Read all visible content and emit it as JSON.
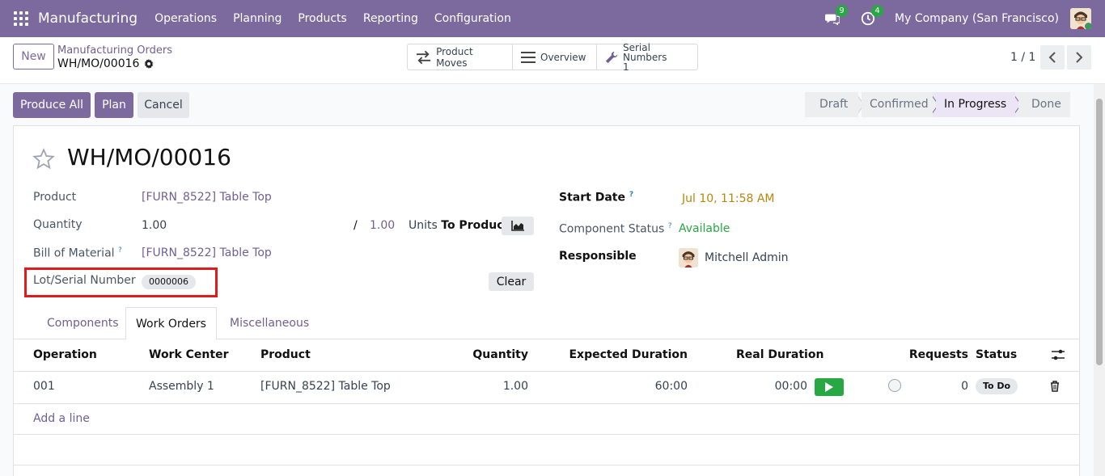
{
  "navbar": {
    "app_name": "Manufacturing",
    "menu": [
      "Operations",
      "Planning",
      "Products",
      "Reporting",
      "Configuration"
    ],
    "messages_count": "9",
    "activities_count": "4",
    "company": "My Company (San Francisco)"
  },
  "control_panel": {
    "new_label": "New",
    "breadcrumb_parent": "Manufacturing Orders",
    "breadcrumb_current": "WH/MO/00016",
    "smart_buttons": {
      "product_moves": "Product Moves",
      "overview": "Overview",
      "serial_numbers_label": "Serial Numbers",
      "serial_numbers_count": "1"
    },
    "pager": "1 / 1"
  },
  "actions": {
    "produce_all": "Produce All",
    "plan": "Plan",
    "cancel": "Cancel"
  },
  "statusbar": {
    "stages": [
      "Draft",
      "Confirmed",
      "In Progress",
      "Done"
    ],
    "active": "In Progress"
  },
  "form": {
    "title": "WH/MO/00016",
    "product_label": "Product",
    "product_value": "[FURN_8522] Table Top",
    "quantity_label": "Quantity",
    "quantity_value": "1.00",
    "quantity_slash": "/",
    "quantity_to_produce": "1.00",
    "uom": "Units",
    "to_produce_label": "To Produce",
    "bom_label": "Bill of Material",
    "bom_value": "[FURN_8522] Table Top",
    "lot_label": "Lot/Serial Number",
    "lot_value": "0000006",
    "clear_label": "Clear",
    "start_date_label": "Start Date",
    "start_date_value": "Jul 10, 11:58 AM",
    "component_status_label": "Component Status",
    "component_status_value": "Available",
    "responsible_label": "Responsible",
    "responsible_value": "Mitchell Admin",
    "help_mark": "?"
  },
  "tabs": [
    "Components",
    "Work Orders",
    "Miscellaneous"
  ],
  "active_tab": "Work Orders",
  "work_orders": {
    "columns": [
      "Operation",
      "Work Center",
      "Product",
      "Quantity",
      "Expected Duration",
      "Real Duration",
      "Requests",
      "Status"
    ],
    "rows": [
      {
        "operation": "001",
        "work_center": "Assembly 1",
        "product": "[FURN_8522] Table Top",
        "quantity": "1.00",
        "expected_duration": "60:00",
        "real_duration": "00:00",
        "requests": "0",
        "status": "To Do"
      }
    ],
    "add_line": "Add a line"
  },
  "colors": {
    "brand": "#7c6a9e",
    "link": "#6f5f92",
    "success": "#28a745",
    "highlight": "#e01b1b",
    "date_warning": "#b8860b"
  }
}
